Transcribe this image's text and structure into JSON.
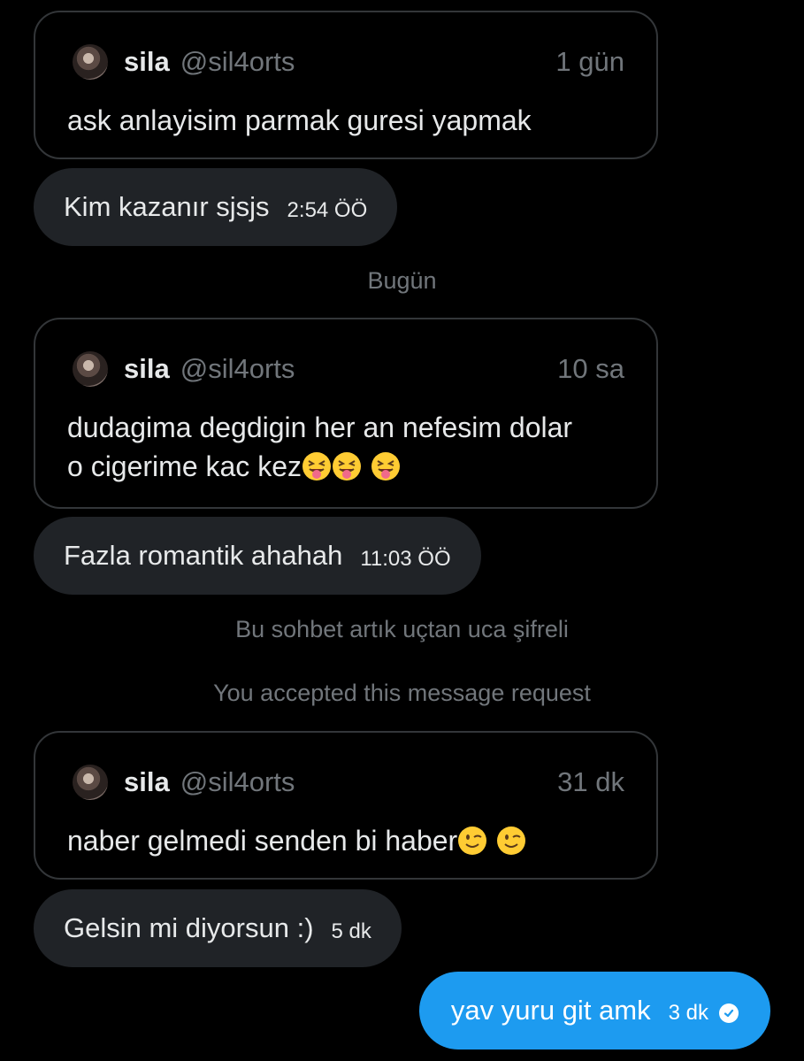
{
  "conversation": {
    "quote1": {
      "name": "sila",
      "handle": "@sil4orts",
      "time": "1 gün",
      "text": "ask anlayisim parmak guresi yapmak"
    },
    "reply1": {
      "text": "Kim kazanır sjsjs",
      "time": "2:54 ÖÖ"
    },
    "day_separator": "Bugün",
    "quote2": {
      "name": "sila",
      "handle": "@sil4orts",
      "time": "10 sa",
      "text_line1": "dudagima degdigin her an nefesim dolar",
      "text_line2": "o cigerime kac kez",
      "emojis": [
        "squinting-tongue-emoji",
        "squinting-tongue-emoji",
        "squinting-tongue-emoji"
      ]
    },
    "reply2": {
      "text": "Fazla romantik ahahah",
      "time": "11:03 ÖÖ"
    },
    "encrypted_notice": "Bu sohbet artık uçtan uca şifreli",
    "request_notice": "You accepted this message request",
    "quote3": {
      "name": "sila",
      "handle": "@sil4orts",
      "time": "31 dk",
      "text": "naber gelmedi senden bi haber",
      "emojis": [
        "winking-face-emoji",
        "winking-face-emoji"
      ]
    },
    "reply3": {
      "text": "Gelsin mi diyorsun :)",
      "time": "5 dk"
    },
    "outgoing": {
      "text": "yav yuru git amk",
      "time": "3 dk",
      "status_icon": "check-circle-icon"
    }
  },
  "colors": {
    "background": "#000000",
    "incoming_bubble": "#202327",
    "outgoing_bubble": "#1d9bf0",
    "card_border": "#333639",
    "muted_text": "#71767b",
    "primary_text": "#e7e9ea"
  }
}
